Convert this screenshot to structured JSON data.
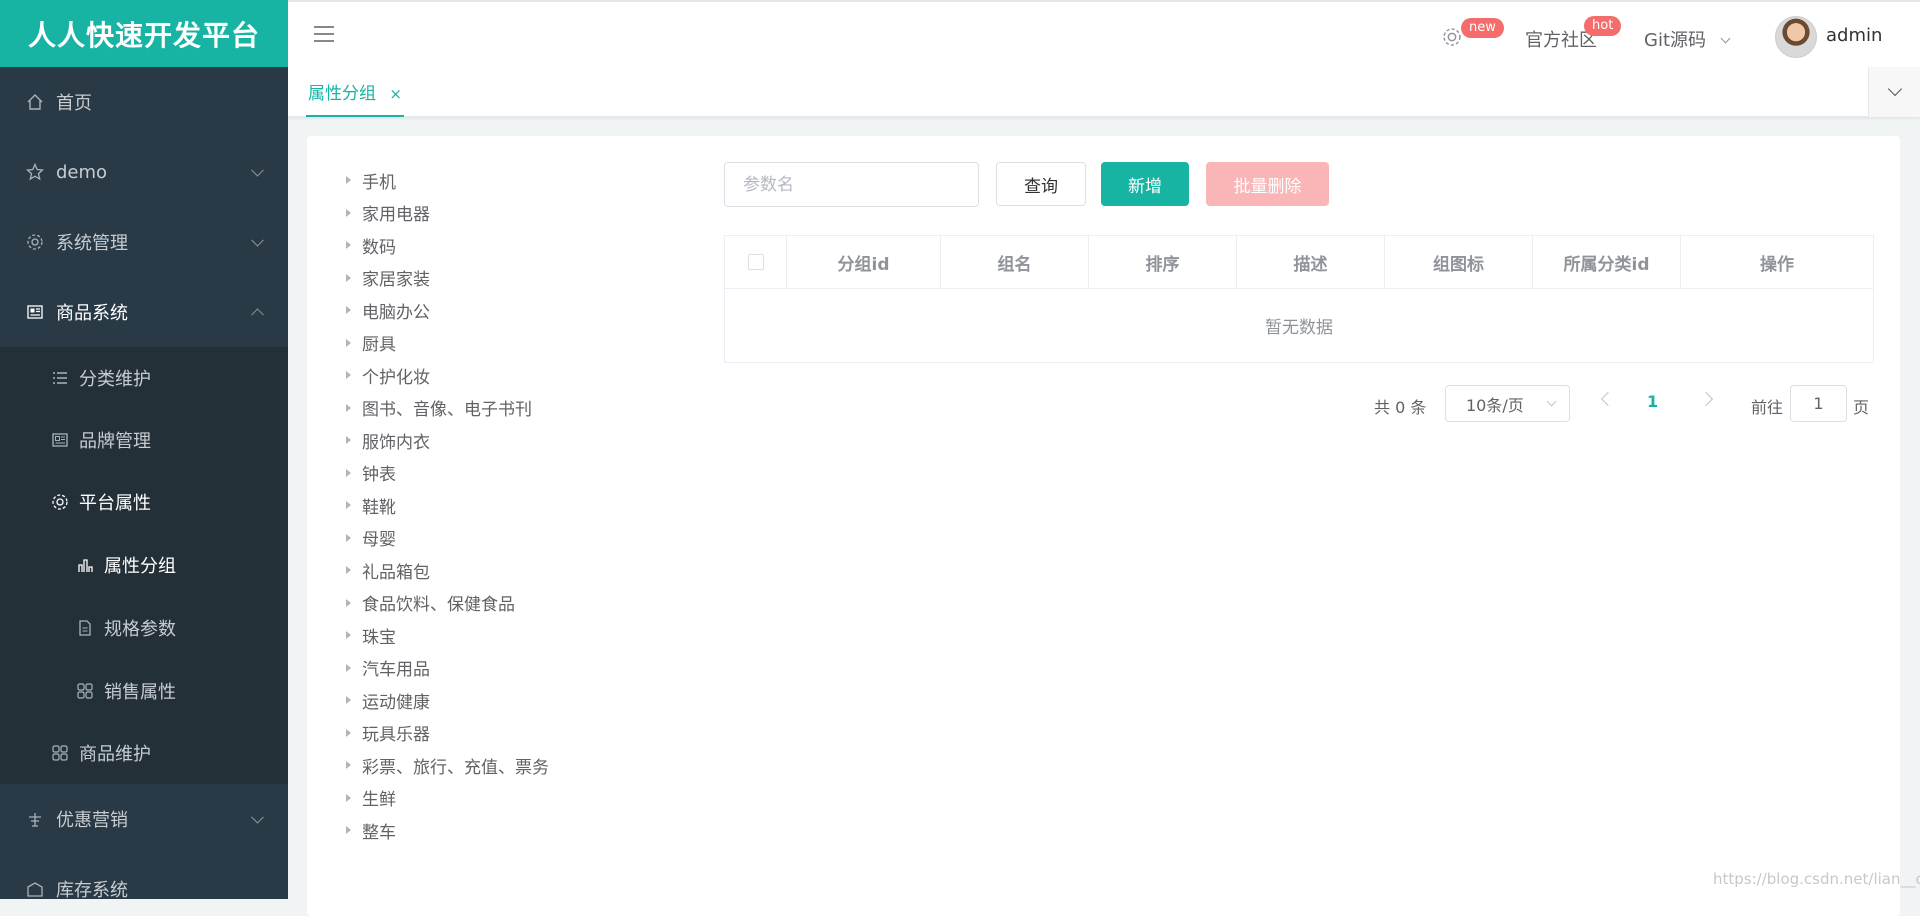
{
  "app": {
    "title": "人人快速开发平台"
  },
  "sidebar": {
    "items": [
      {
        "label": "首页",
        "icon": "home-icon"
      },
      {
        "label": "demo",
        "icon": "star-icon"
      },
      {
        "label": "系统管理",
        "icon": "gear-icon"
      },
      {
        "label": "商品系统",
        "icon": "newspaper-icon"
      },
      {
        "label": "优惠营销",
        "icon": "marketing-icon"
      },
      {
        "label": "库存系统",
        "icon": "warehouse-icon"
      }
    ],
    "goods_sub": [
      {
        "label": "分类维护",
        "icon": "list-icon"
      },
      {
        "label": "品牌管理",
        "icon": "picture-icon"
      },
      {
        "label": "平台属性",
        "icon": "gear-icon"
      },
      {
        "label": "商品维护",
        "icon": "grid-icon"
      }
    ],
    "attr_sub": [
      {
        "label": "属性分组",
        "icon": "bar-chart-icon"
      },
      {
        "label": "规格参数",
        "icon": "document-icon"
      },
      {
        "label": "销售属性",
        "icon": "grid-icon"
      }
    ]
  },
  "header": {
    "badge_new": "new",
    "community": "官方社区",
    "badge_hot": "hot",
    "git": "Git源码",
    "username": "admin"
  },
  "tabs": [
    {
      "label": "属性分组",
      "close": "×"
    }
  ],
  "tree": [
    "手机",
    "家用电器",
    "数码",
    "家居家装",
    "电脑办公",
    "厨具",
    "个护化妆",
    "图书、音像、电子书刊",
    "服饰内衣",
    "钟表",
    "鞋靴",
    "母婴",
    "礼品箱包",
    "食品饮料、保健食品",
    "珠宝",
    "汽车用品",
    "运动健康",
    "玩具乐器",
    "彩票、旅行、充值、票务",
    "生鲜",
    "整车"
  ],
  "toolbar": {
    "search_placeholder": "参数名",
    "query_label": "查询",
    "add_label": "新增",
    "batch_delete_label": "批量删除"
  },
  "table": {
    "columns": [
      "分组id",
      "组名",
      "排序",
      "描述",
      "组图标",
      "所属分类id",
      "操作"
    ],
    "empty_text": "暂无数据"
  },
  "pagination": {
    "total": "共 0 条",
    "page_size": "10条/页",
    "current": "1",
    "goto": "前往",
    "goto_value": "1",
    "page_unit": "页"
  },
  "watermark": "https://blog.csdn.net/lian__c",
  "colors": {
    "brand": "#17b3a3",
    "sidebar": "#293a46",
    "danger_light": "#fab6b6",
    "badge": "#f56c6c"
  }
}
